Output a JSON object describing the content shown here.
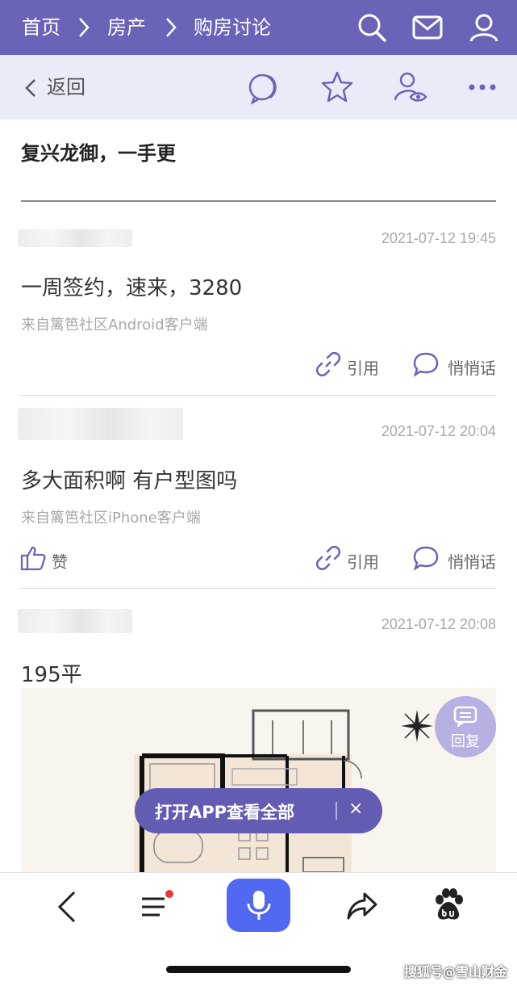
{
  "breadcrumb": {
    "home": "首页",
    "section": "房产",
    "board": "购房讨论"
  },
  "subbar": {
    "back_label": "返回"
  },
  "thread": {
    "title": "复兴龙御，一手更"
  },
  "posts": [
    {
      "time": "2021-07-12 19:45",
      "text": "一周签约，速来，3280",
      "source": "来自篱笆社区Android客户端",
      "quote_label": "引用",
      "pm_label": "悄悄话"
    },
    {
      "time": "2021-07-12 20:04",
      "text": "多大面积啊 有户型图吗",
      "source": "来自篱笆社区iPhone客户端",
      "like_label": "赞",
      "quote_label": "引用",
      "pm_label": "悄悄话"
    },
    {
      "time": "2021-07-12 20:08",
      "text": "195平"
    }
  ],
  "reply_fab": {
    "label": "回复"
  },
  "open_app": {
    "label": "打开APP查看全部",
    "close": "×"
  },
  "watermark": "搜狐号@雪山财金",
  "colors": {
    "brand": "#6a64b8",
    "subbar": "#eaebf8",
    "fab": "#b7b1e3",
    "badge": "#e53935",
    "voice": "#5069f0"
  }
}
